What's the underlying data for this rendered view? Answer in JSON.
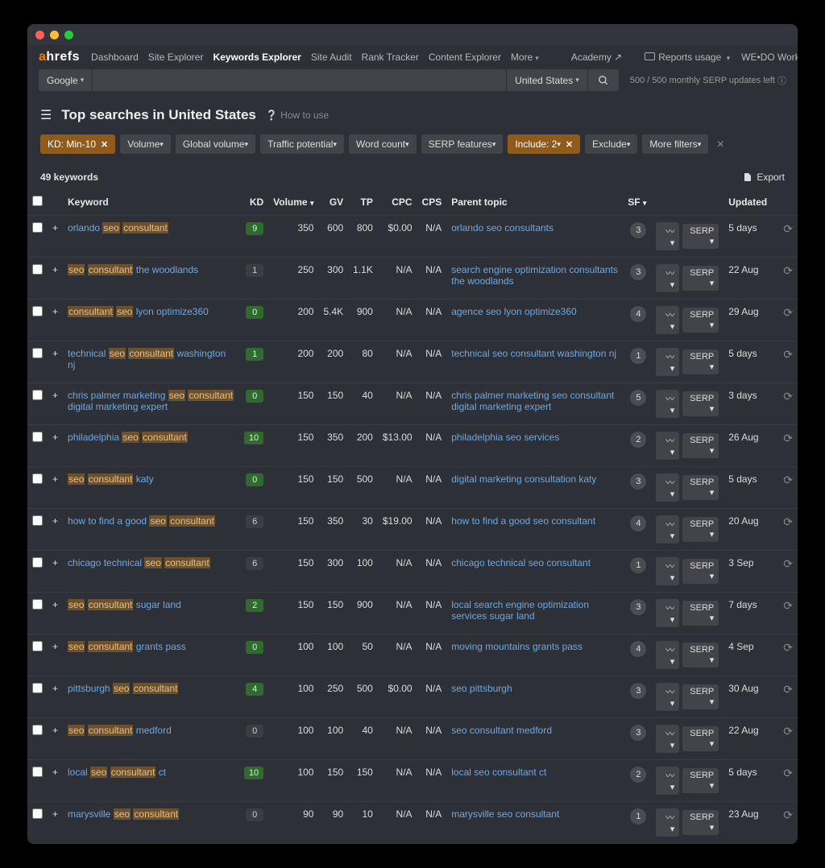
{
  "brand": {
    "a": "a",
    "rest": "hrefs"
  },
  "nav": {
    "items": [
      "Dashboard",
      "Site Explorer",
      "Keywords Explorer",
      "Site Audit",
      "Rank Tracker",
      "Content Explorer",
      "More"
    ],
    "active_index": 2,
    "academy": "Academy ↗",
    "reports": "Reports usage",
    "workspace": "WE•DO Workspace"
  },
  "search": {
    "engine": "Google",
    "country": "United States",
    "serp_status": "500 / 500 monthly SERP updates left"
  },
  "page": {
    "title": "Top searches in United States",
    "howto": "How to use"
  },
  "filters": {
    "items": [
      {
        "label": "KD: Min-10",
        "active": true,
        "close": true
      },
      {
        "label": "Volume",
        "active": false,
        "caret": true
      },
      {
        "label": "Global volume",
        "active": false,
        "caret": true
      },
      {
        "label": "Traffic potential",
        "active": false,
        "caret": true
      },
      {
        "label": "Word count",
        "active": false,
        "caret": true
      },
      {
        "label": "SERP features",
        "active": false,
        "caret": true
      },
      {
        "label": "Include: 2",
        "active": true,
        "close": true,
        "caret": true
      },
      {
        "label": "Exclude",
        "active": false,
        "caret": true
      },
      {
        "label": "More filters",
        "active": false,
        "caret": true
      }
    ]
  },
  "result_count": "49 keywords",
  "export": "Export",
  "columns": [
    "Keyword",
    "KD",
    "Volume",
    "GV",
    "TP",
    "CPC",
    "CPS",
    "Parent topic",
    "SF",
    "Updated"
  ],
  "serp_btn": "SERP",
  "rows": [
    {
      "kw": "orlando seo consultant",
      "hl": [
        "seo",
        "consultant"
      ],
      "kd": 9,
      "kdc": "g",
      "vol": 350,
      "gv": 600,
      "tp": "800",
      "cpc": "$0.00",
      "cps": "N/A",
      "parent": "orlando seo consultants",
      "sf": 3,
      "updated": "5 days"
    },
    {
      "kw": "seo consultant the woodlands",
      "hl": [
        "seo",
        "consultant"
      ],
      "kd": 1,
      "kdc": "d",
      "vol": 250,
      "gv": 300,
      "tp": "1.1K",
      "cpc": "N/A",
      "cps": "N/A",
      "parent": "search engine optimization consultants the woodlands",
      "sf": 3,
      "updated": "22 Aug"
    },
    {
      "kw": "consultant seo lyon optimize360",
      "hl": [
        "consultant",
        "seo"
      ],
      "kd": 0,
      "kdc": "g",
      "vol": 200,
      "gv": "5.4K",
      "tp": "900",
      "cpc": "N/A",
      "cps": "N/A",
      "parent": "agence seo lyon optimize360",
      "sf": 4,
      "updated": "29 Aug"
    },
    {
      "kw": "technical seo consultant washington nj",
      "hl": [
        "seo",
        "consultant"
      ],
      "kd": 1,
      "kdc": "g",
      "vol": 200,
      "gv": 200,
      "tp": "80",
      "cpc": "N/A",
      "cps": "N/A",
      "parent": "technical seo consultant washington nj",
      "sf": 1,
      "updated": "5 days"
    },
    {
      "kw": "chris palmer marketing seo consultant digital marketing expert",
      "hl": [
        "seo",
        "consultant"
      ],
      "kd": 0,
      "kdc": "g",
      "vol": 150,
      "gv": 150,
      "tp": "40",
      "cpc": "N/A",
      "cps": "N/A",
      "parent": "chris palmer marketing seo consultant digital marketing expert",
      "sf": 5,
      "updated": "3 days"
    },
    {
      "kw": "philadelphia seo consultant",
      "hl": [
        "seo",
        "consultant"
      ],
      "kd": 10,
      "kdc": "g",
      "vol": 150,
      "gv": 350,
      "tp": "200",
      "cpc": "$13.00",
      "cps": "N/A",
      "parent": "philadelphia seo services",
      "sf": 2,
      "updated": "26 Aug"
    },
    {
      "kw": "seo consultant katy",
      "hl": [
        "seo",
        "consultant"
      ],
      "kd": 0,
      "kdc": "g",
      "vol": 150,
      "gv": 150,
      "tp": "500",
      "cpc": "N/A",
      "cps": "N/A",
      "parent": "digital marketing consultation katy",
      "sf": 3,
      "updated": "5 days"
    },
    {
      "kw": "how to find a good seo consultant",
      "hl": [
        "seo",
        "consultant"
      ],
      "kd": 6,
      "kdc": "d",
      "vol": 150,
      "gv": 350,
      "tp": "30",
      "cpc": "$19.00",
      "cps": "N/A",
      "parent": "how to find a good seo consultant",
      "sf": 4,
      "updated": "20 Aug"
    },
    {
      "kw": "chicago technical seo consultant",
      "hl": [
        "seo",
        "consultant"
      ],
      "kd": 6,
      "kdc": "d",
      "vol": 150,
      "gv": 300,
      "tp": "100",
      "cpc": "N/A",
      "cps": "N/A",
      "parent": "chicago technical seo consultant",
      "sf": 1,
      "updated": "3 Sep"
    },
    {
      "kw": "seo consultant sugar land",
      "hl": [
        "seo",
        "consultant"
      ],
      "kd": 2,
      "kdc": "g",
      "vol": 150,
      "gv": 150,
      "tp": "900",
      "cpc": "N/A",
      "cps": "N/A",
      "parent": "local search engine optimization services sugar land",
      "sf": 3,
      "updated": "7 days"
    },
    {
      "kw": "seo consultant grants pass",
      "hl": [
        "seo",
        "consultant"
      ],
      "kd": 0,
      "kdc": "g",
      "vol": 100,
      "gv": 100,
      "tp": "50",
      "cpc": "N/A",
      "cps": "N/A",
      "parent": "moving mountains grants pass",
      "sf": 4,
      "updated": "4 Sep"
    },
    {
      "kw": "pittsburgh seo consultant",
      "hl": [
        "seo",
        "consultant"
      ],
      "kd": 4,
      "kdc": "g",
      "vol": 100,
      "gv": 250,
      "tp": "500",
      "cpc": "$0.00",
      "cps": "N/A",
      "parent": "seo pittsburgh",
      "sf": 3,
      "updated": "30 Aug"
    },
    {
      "kw": "seo consultant medford",
      "hl": [
        "seo",
        "consultant"
      ],
      "kd": 0,
      "kdc": "d",
      "vol": 100,
      "gv": 100,
      "tp": "40",
      "cpc": "N/A",
      "cps": "N/A",
      "parent": "seo consultant medford",
      "sf": 3,
      "updated": "22 Aug"
    },
    {
      "kw": "local seo consultant ct",
      "hl": [
        "seo",
        "consultant"
      ],
      "kd": 10,
      "kdc": "g",
      "vol": 100,
      "gv": 150,
      "tp": "150",
      "cpc": "N/A",
      "cps": "N/A",
      "parent": "local seo consultant ct",
      "sf": 2,
      "updated": "5 days"
    },
    {
      "kw": "marysville seo consultant",
      "hl": [
        "seo",
        "consultant"
      ],
      "kd": 0,
      "kdc": "d",
      "vol": 90,
      "gv": 90,
      "tp": "10",
      "cpc": "N/A",
      "cps": "N/A",
      "parent": "marysville seo consultant",
      "sf": 1,
      "updated": "23 Aug"
    }
  ]
}
